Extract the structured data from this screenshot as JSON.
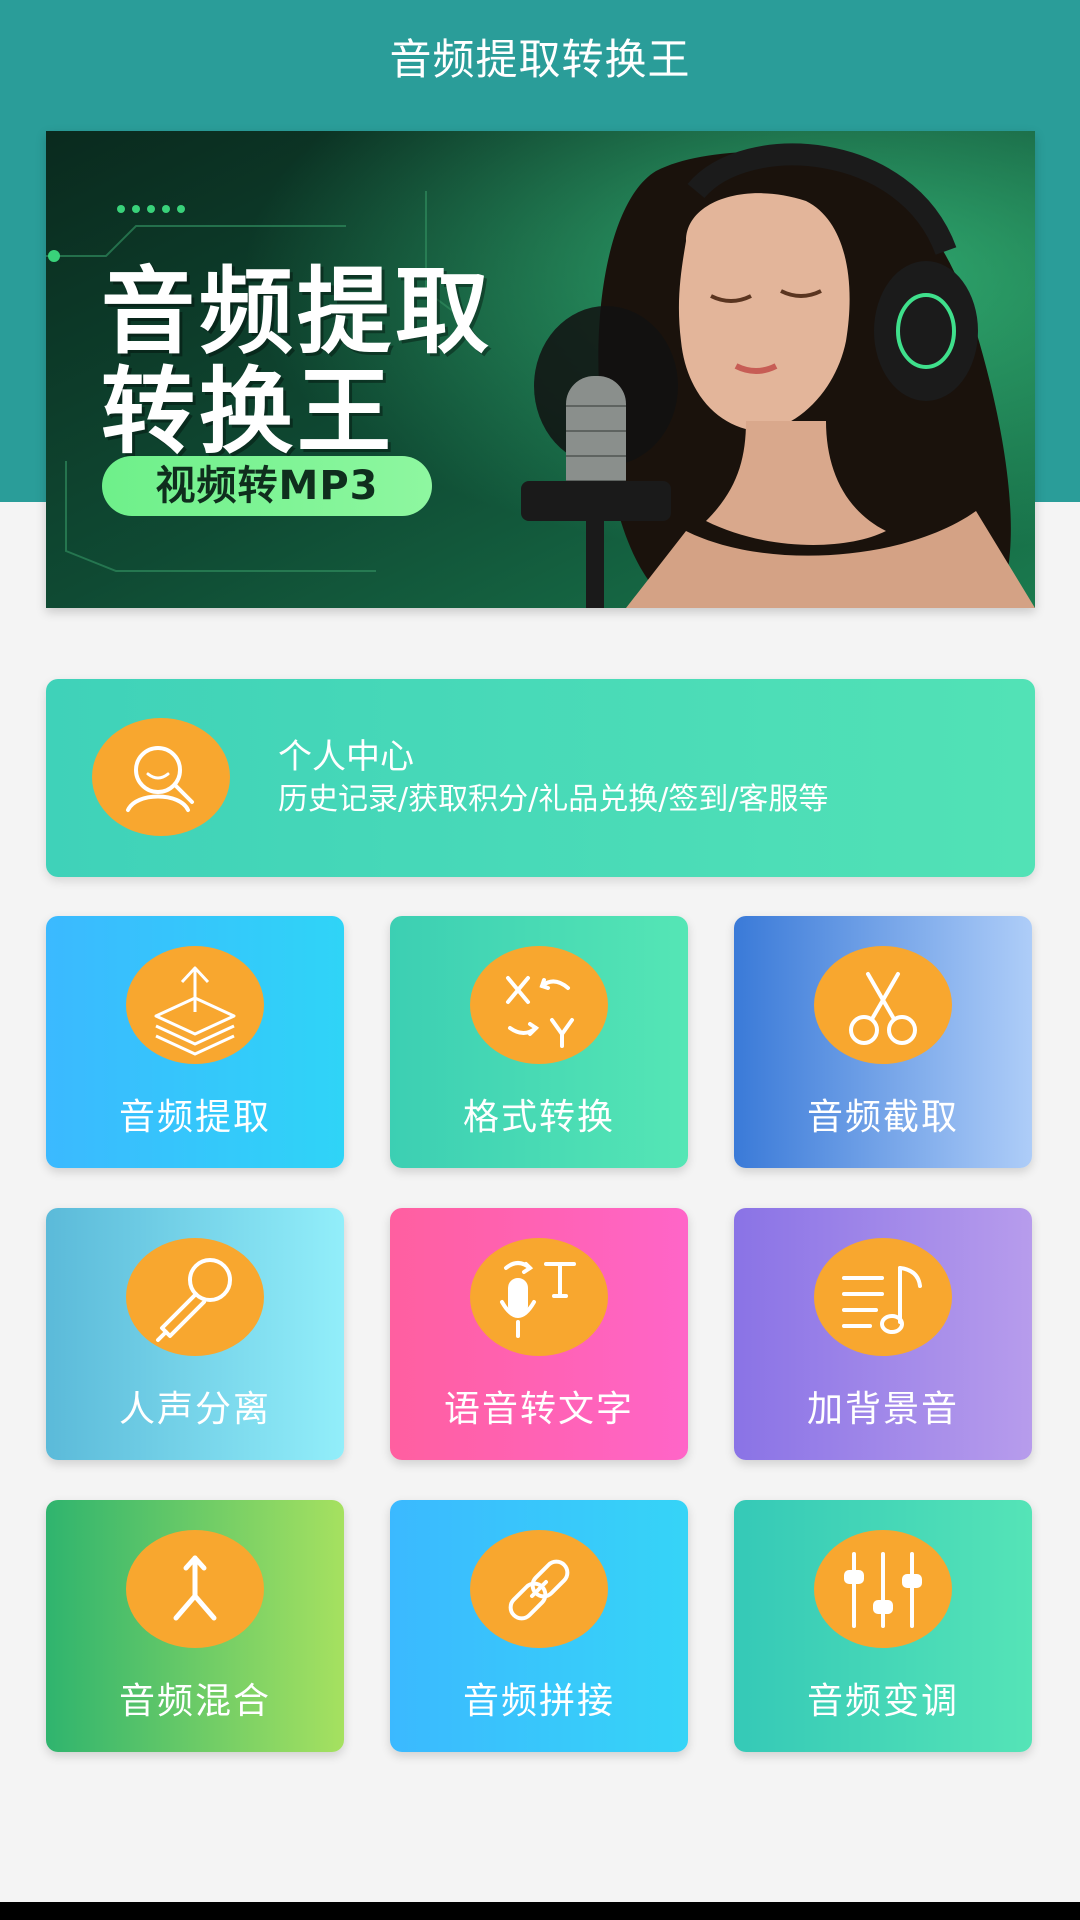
{
  "header": {
    "title": "音频提取转换王"
  },
  "banner": {
    "title_line1": "音频提取",
    "title_line2": "转换王",
    "pill": "视频转MP3"
  },
  "profile": {
    "title": "个人中心",
    "subtitle": "历史记录/获取积分/礼品兑换/签到/客服等",
    "icon": "user-search-icon"
  },
  "tools": [
    {
      "label": "音频提取",
      "icon": "upload-layers-icon",
      "gradient": [
        "#3bb9ff",
        "#2fd4f7"
      ]
    },
    {
      "label": "格式转换",
      "icon": "x-to-y-convert-icon",
      "gradient": [
        "#3ccfb3",
        "#55e6b5"
      ]
    },
    {
      "label": "音频截取",
      "icon": "scissors-icon",
      "gradient": [
        "#3a7ad8",
        "#aecdf8"
      ]
    },
    {
      "label": "人声分离",
      "icon": "microphone-icon",
      "gradient": [
        "#5bbad9",
        "#92eefa"
      ]
    },
    {
      "label": "语音转文字",
      "icon": "speech-to-text-icon",
      "gradient": [
        "#ff5fa0",
        "#ff65c8"
      ]
    },
    {
      "label": "加背景音",
      "icon": "music-note-icon",
      "gradient": [
        "#8a73e6",
        "#b79cec"
      ]
    },
    {
      "label": "音频混合",
      "icon": "merge-arrow-icon",
      "gradient": [
        "#2fb46e",
        "#a6e160"
      ]
    },
    {
      "label": "音频拼接",
      "icon": "link-icon",
      "gradient": [
        "#3bb9ff",
        "#36d4f7"
      ]
    },
    {
      "label": "音频变调",
      "icon": "equalizer-sliders-icon",
      "gradient": [
        "#35c9b7",
        "#55e4b7"
      ]
    }
  ],
  "colors": {
    "header": "#2a9d99",
    "icon_circle": "#f8a72f",
    "page_background": "#f4f4f4"
  }
}
